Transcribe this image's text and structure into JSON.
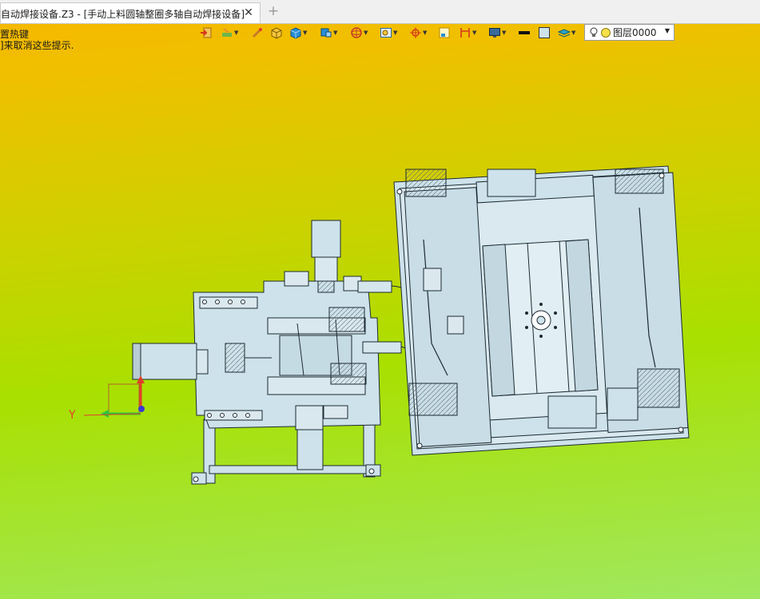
{
  "tab": {
    "title": "自动焊接设备.Z3 - [手动上料圆轴整圈多轴自动焊接设备]",
    "close_icon": "close-icon",
    "new_tab_icon": "plus-icon"
  },
  "hints": {
    "line1": "置热键",
    "line2": "]来取消这些提示."
  },
  "toolbar": {
    "icons": [
      "exit-sketch-icon",
      "palette-icon",
      "brush-icon",
      "box-shade-icon",
      "cube-icon",
      "view-cube-icon",
      "trackball-icon",
      "zoom-box-icon",
      "target-icon",
      "frame-icon",
      "section-icon",
      "monitor-icon",
      "black-line-icon",
      "color-swatch-icon",
      "layer-stack-icon"
    ]
  },
  "layer": {
    "label": "图层0000"
  },
  "axes": {
    "y_label": "Y"
  },
  "colors": {
    "bg_top": "#f7b600",
    "bg_bottom": "#a0e860",
    "part_fill": "#cde2ea",
    "part_stroke": "#1d2a33",
    "axis_red": "#e23d2a",
    "axis_green": "#2ec43a",
    "axis_blue": "#3a3ad0"
  }
}
